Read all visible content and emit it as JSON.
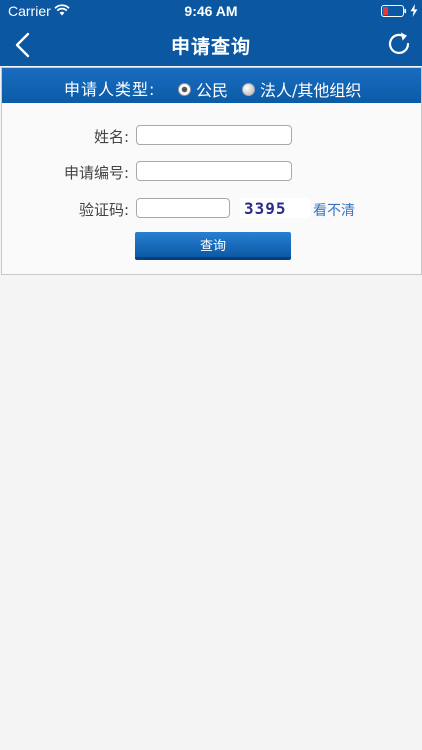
{
  "status_bar": {
    "carrier": "Carrier",
    "time": "9:46 AM",
    "battery_color": "#e53935"
  },
  "nav": {
    "title": "申请查询",
    "back_icon": "chevron-left-icon",
    "refresh_icon": "refresh-icon",
    "background_color": "#0b57a2"
  },
  "form": {
    "applicant_type": {
      "label": "申请人类型:",
      "options": [
        {
          "label": "公民",
          "selected": true
        },
        {
          "label": "法人/其他组织",
          "selected": false
        }
      ]
    },
    "name": {
      "label": "姓名:",
      "value": ""
    },
    "application_no": {
      "label": "申请编号:",
      "value": ""
    },
    "captcha": {
      "label": "验证码:",
      "value": "",
      "image_text": "3395",
      "refresh_link": "看不清"
    },
    "submit_label": "查询",
    "accent_color": "#0b5ba6"
  }
}
